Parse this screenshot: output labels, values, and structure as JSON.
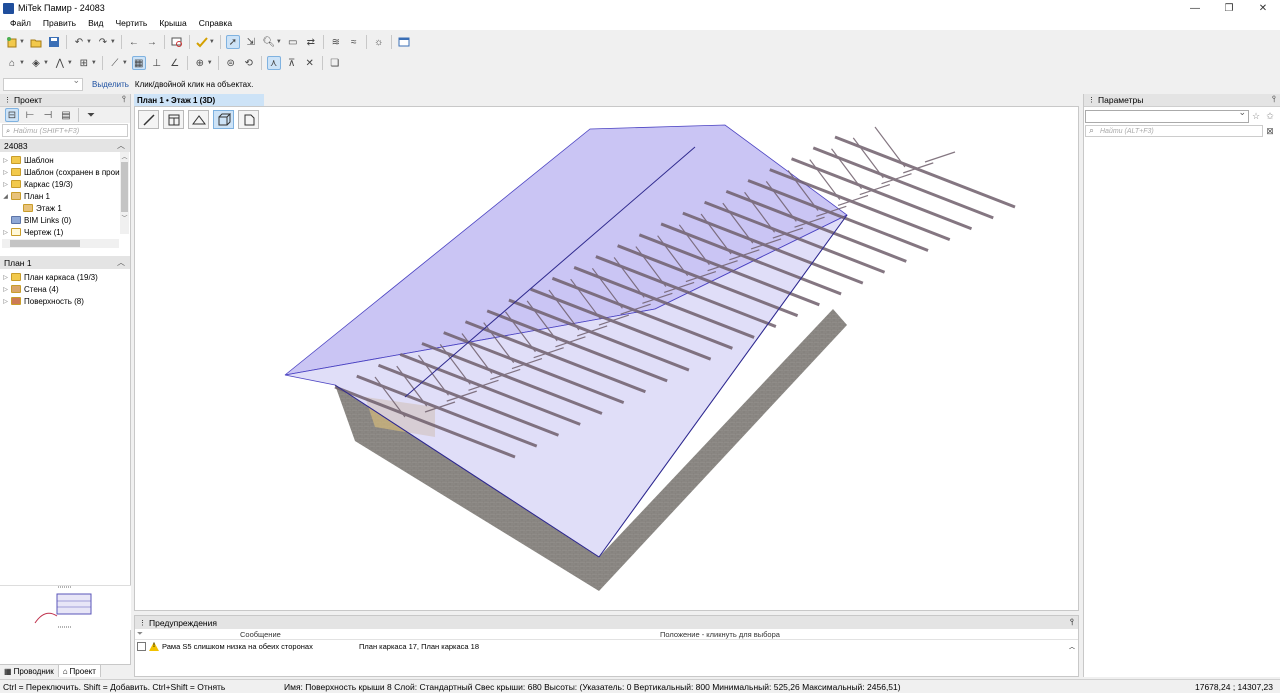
{
  "window": {
    "title": "MiTek Памир - 24083",
    "minimize": "—",
    "restore": "❐",
    "close": "✕"
  },
  "menu": [
    "Файл",
    "Править",
    "Вид",
    "Чертить",
    "Крыша",
    "Справка"
  ],
  "select_line": {
    "action": "Выделить",
    "hint": "Клик/двойной клик на объектах."
  },
  "project_panel": {
    "title": "Проект",
    "search_placeholder": "Найти (SHIFT+F3)",
    "project_name": "24083",
    "tree": [
      {
        "label": "Шаблон",
        "icon": "folder-icon",
        "level": 0,
        "expander": "▷"
      },
      {
        "label": "Шаблон (сохранен в произв",
        "icon": "folder-icon",
        "level": 0,
        "expander": "▷"
      },
      {
        "label": "Каркас (19/3)",
        "icon": "folder-icon",
        "level": 0,
        "expander": "▷"
      },
      {
        "label": "План 1",
        "icon": "plan-icon",
        "level": 0,
        "expander": "◢"
      },
      {
        "label": "Этаж 1",
        "icon": "floor-icon",
        "level": 1,
        "expander": ""
      },
      {
        "label": "BIM Links (0)",
        "icon": "bim-icon",
        "level": 0,
        "expander": ""
      },
      {
        "label": "Чертеж (1)",
        "icon": "drawing-icon",
        "level": 0,
        "expander": "▷"
      }
    ],
    "plan_section": "План 1",
    "plan_tree": [
      {
        "label": "План каркаса (19/3)",
        "icon": "frame-plan-icon",
        "expander": "▷"
      },
      {
        "label": "Стена (4)",
        "icon": "wall-icon",
        "expander": "▷"
      },
      {
        "label": "Поверхность (8)",
        "icon": "surface-icon",
        "expander": "▷"
      }
    ],
    "tabs": [
      {
        "label": "Проводник",
        "active": false
      },
      {
        "label": "Проект",
        "active": true
      }
    ]
  },
  "viewport": {
    "tab": "План 1 • Этаж 1 (3D)"
  },
  "params_panel": {
    "title": "Параметры",
    "search_placeholder": "Найти (ALT+F3)"
  },
  "warnings": {
    "title": "Предупреждения",
    "col_message": "Сообщение",
    "col_location": "Положение - кликнуть для выбора",
    "rows": [
      {
        "message": "Рама S5 слишком низка на обеих сторонах",
        "location": "План каркаса 17, План каркаса 18"
      }
    ]
  },
  "status": {
    "left": "Ctrl = Переключить. Shift = Добавить. Ctrl+Shift = Отнять",
    "middle": "Имя: Поверхность крыши 8  Слой: Стандартный  Свес крыши: 680  Высоты: (Указатель: 0 Вертикальный: 800 Минимальный: 525,26 Максимальный: 2456,51)",
    "coords": "17678,24 ; 14307,23"
  },
  "colors": {
    "accent": "#cde3f7",
    "roof_glass": "#9c93e8",
    "truss": "#7c6a78",
    "wall": "#8d8a87"
  }
}
